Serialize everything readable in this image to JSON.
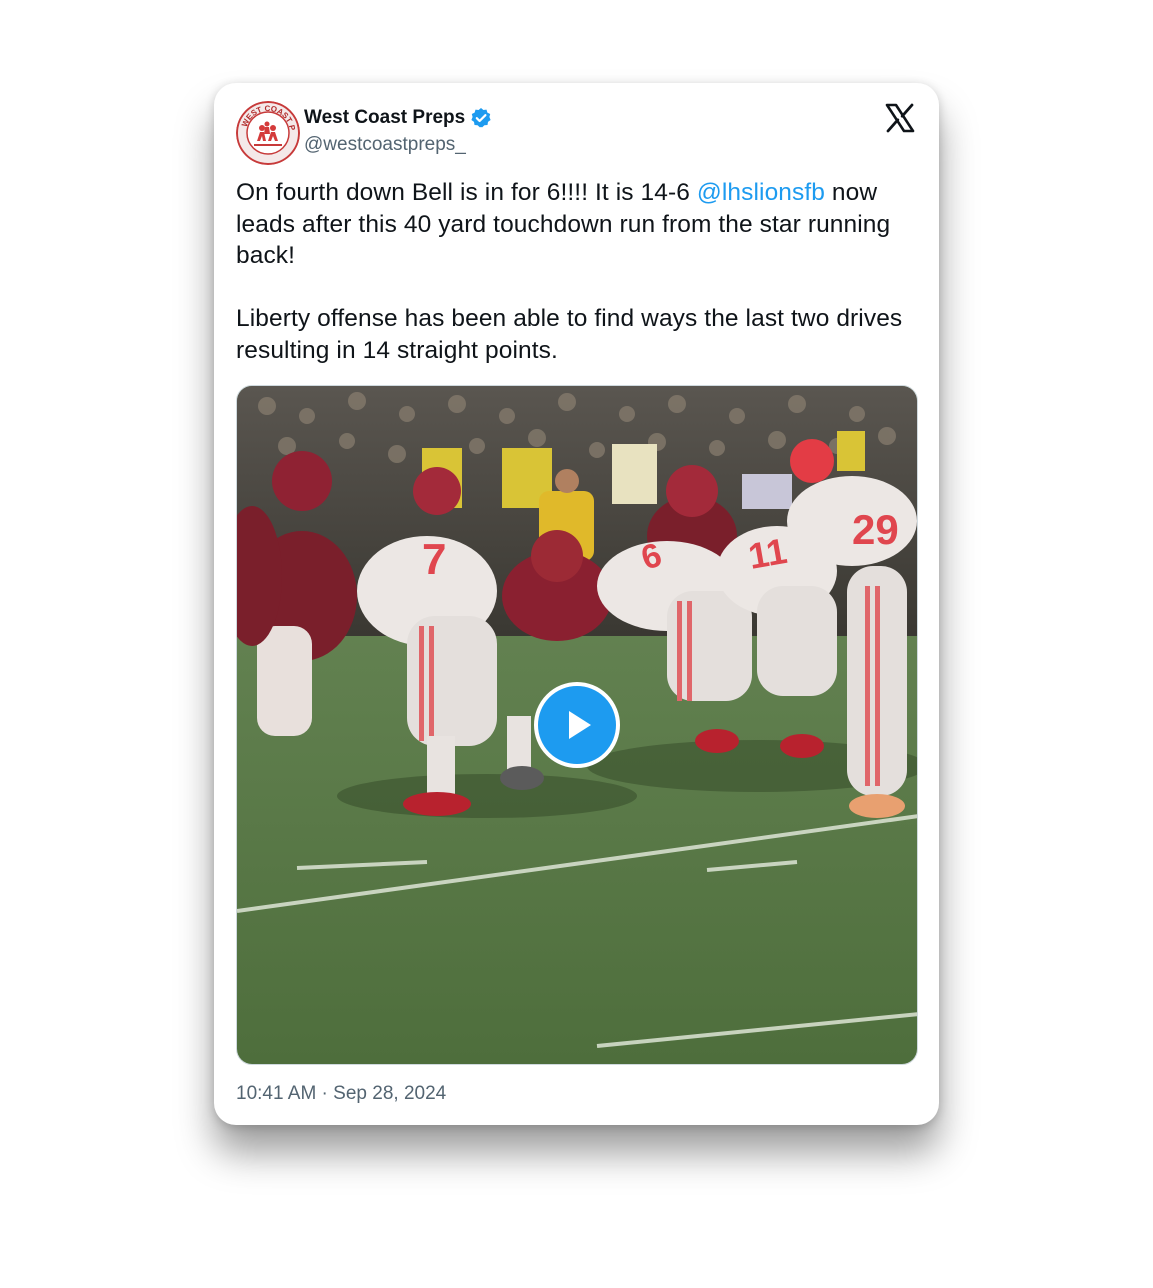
{
  "author": {
    "display_name": "West Coast Preps",
    "handle": "@westcoastpreps_",
    "avatar_icon": "west-coast-preps-logo",
    "avatar_logo_text": "WEST COAST PREPS",
    "verified": true,
    "verified_color": "#1d9bf0"
  },
  "platform_icon": "x-logo-icon",
  "tweet": {
    "line1_before": "On fourth down Bell is in for 6!!!! It is 14-6 ",
    "mention": "@lhslionsfb",
    "line1_after": " now leads after this 40 yard touchdown run from the star running back!",
    "paragraph2": "Liberty offense has been able to find ways the last two drives resulting in 14 straight points."
  },
  "media": {
    "type": "video",
    "play_icon": "play-icon",
    "jersey_numbers": [
      "7",
      "6",
      "11",
      "29"
    ]
  },
  "timestamp": "10:41 AM · Sep 28, 2024",
  "colors": {
    "text": "#0f1419",
    "secondary": "#536471",
    "accent": "#1d9bf0"
  }
}
